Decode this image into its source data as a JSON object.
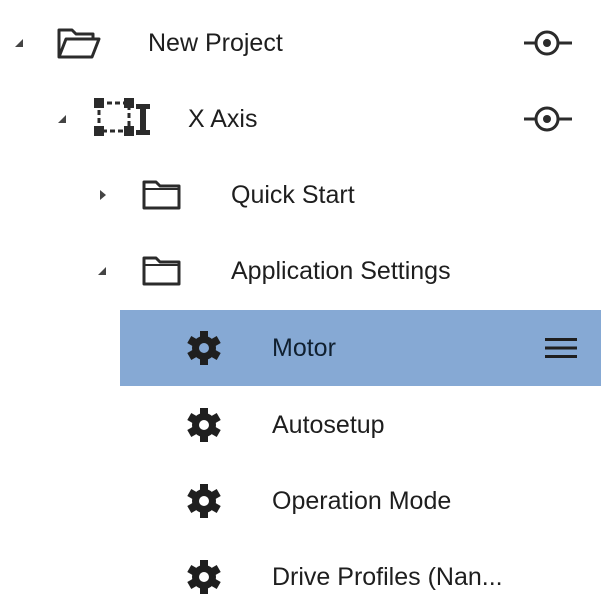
{
  "tree": {
    "items": [
      {
        "label": "New Project",
        "icon": "folder-open-icon",
        "expander": "expanded",
        "action_icon": "link-icon"
      },
      {
        "label": "X Axis",
        "icon": "axis-device-icon",
        "expander": "expanded",
        "action_icon": "link-icon"
      },
      {
        "label": "Quick Start",
        "icon": "folder-icon",
        "expander": "collapsed"
      },
      {
        "label": "Application Settings",
        "icon": "folder-icon",
        "expander": "expanded"
      },
      {
        "label": "Motor",
        "icon": "gear-icon",
        "selected": true,
        "action_icon": "menu-icon"
      },
      {
        "label": "Autosetup",
        "icon": "gear-icon"
      },
      {
        "label": "Operation Mode",
        "icon": "gear-icon"
      },
      {
        "label": "Drive Profiles (Nan...",
        "icon": "gear-icon"
      }
    ]
  },
  "colors": {
    "selection": "#86a9d4",
    "text": "#1e1e1e",
    "icon": "#2b2b2b"
  }
}
